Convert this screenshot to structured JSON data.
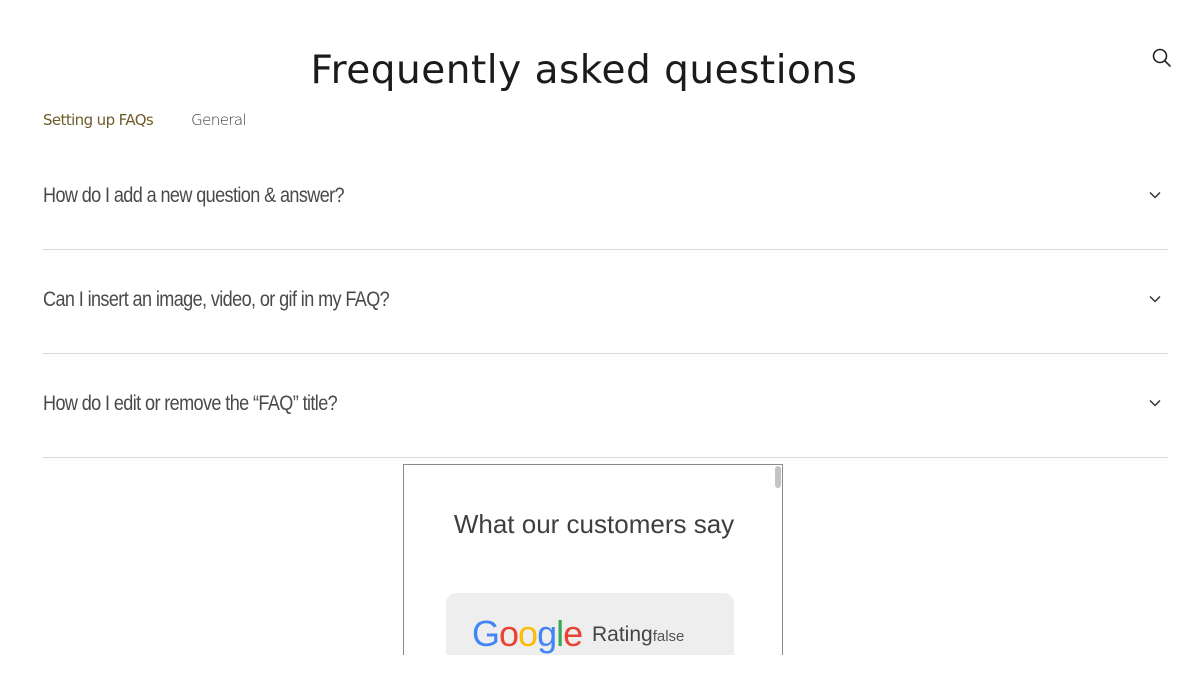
{
  "header": {
    "title": "Frequently asked questions",
    "search_icon": "search-icon"
  },
  "tabs": [
    {
      "label": "Setting up FAQs",
      "active": true
    },
    {
      "label": "General",
      "active": false
    }
  ],
  "faqs": [
    {
      "question": "How do I add a new question & answer?",
      "icon": "chevron-down-icon"
    },
    {
      "question": "Can I insert an image, video, or gif in my FAQ?",
      "icon": "chevron-down-icon"
    },
    {
      "question": "How do I edit or remove the “FAQ” title?",
      "icon": "chevron-down-icon"
    }
  ],
  "reviews_widget": {
    "title": "What our customers say",
    "logo_text": [
      "G",
      "o",
      "o",
      "g",
      "l",
      "e"
    ],
    "rating_label": "Rating",
    "rating_value": "false"
  },
  "colors": {
    "active_tab": "#6e5c2a",
    "text": "#4a4a4a",
    "divider": "#dadada",
    "card_bg": "#eeeeee"
  }
}
